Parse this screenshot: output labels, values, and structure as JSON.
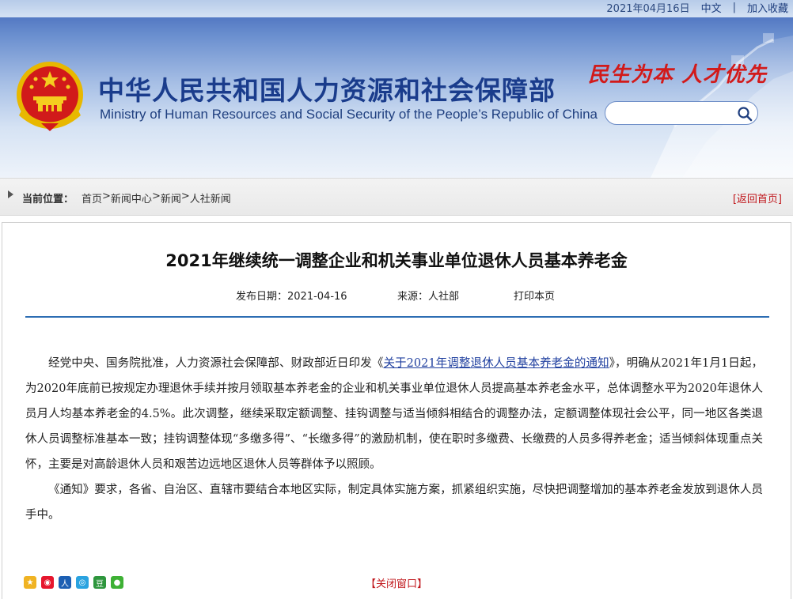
{
  "topbar": {
    "date": "2021年04月16日",
    "lang": "中文",
    "separator": "|",
    "bookmark": "加入收藏"
  },
  "header": {
    "title_cn": "中华人民共和国人力资源和社会保障部",
    "title_en": "Ministry of Human Resources and Social Security of the People’s Republic of China",
    "slogan": "民生为本  人才优先",
    "search": {
      "value": "",
      "placeholder": ""
    }
  },
  "breadcrumb": {
    "label": "当前位置：",
    "items": [
      "首页",
      "新闻中心",
      "新闻",
      "人社新闻"
    ],
    "separator": ">",
    "back_home": "[返回首页]"
  },
  "article": {
    "title": "2021年继续统一调整企业和机关事业单位退休人员基本养老金",
    "publish_date": "发布日期：2021-04-16",
    "source": "来源：人社部",
    "print": "打印本页",
    "para1_prefix": "经党中央、国务院批准，人力资源社会保障部、财政部近日印发《",
    "para1_link": "关于2021年调整退休人员基本养老金的通知",
    "para1_suffix": "》，明确从2021年1月1日起，为2020年底前已按规定办理退休手续并按月领取基本养老金的企业和机关事业单位退休人员提高基本养老金水平，总体调整水平为2020年退休人员月人均基本养老金的4.5%。此次调整，继续采取定额调整、挂钩调整与适当倾斜相结合的调整办法，定额调整体现社会公平，同一地区各类退休人员调整标准基本一致；挂钩调整体现“多缴多得”、“长缴多得”的激励机制，使在职时多缴费、长缴费的人员多得养老金；适当倾斜体现重点关怀，主要是对高龄退休人员和艰苦边远地区退休人员等群体予以照顾。",
    "para2": "《通知》要求，各省、自治区、直辖市要结合本地区实际，制定具体实施方案，抓紧组织实施，尽快把调整增加的基本养老金发放到退休人员手中。"
  },
  "footer": {
    "close": "【关闭窗口】",
    "share_icons": [
      "qzone-icon",
      "weibo-icon",
      "renren-icon",
      "tqq-icon",
      "douban-icon",
      "wechat-icon"
    ]
  },
  "colors": {
    "brand_blue": "#1a3c8c",
    "slogan_red": "#d21a1a",
    "link_red": "#c0161b",
    "divider_blue": "#2d6db3"
  }
}
